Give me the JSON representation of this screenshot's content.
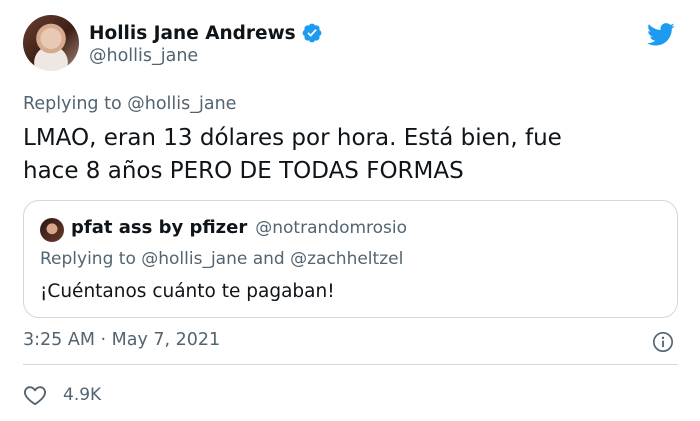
{
  "author": {
    "display_name": "Hollis Jane Andrews",
    "handle": "@hollis_jane",
    "verified": true,
    "avatar": "profile-photo"
  },
  "brand_icon": "twitter-bird-icon",
  "colors": {
    "brand_blue": "#1d9bf0",
    "text_primary": "#0f1419",
    "text_secondary": "#536471",
    "border": "#cfd9de"
  },
  "tweet": {
    "replying_prefix": "Replying to",
    "replying_handle": "@hollis_jane",
    "text_line1": "LMAO, eran 13 dólares por hora. Está bien, fue",
    "text_line2": "hace 8 años PERO DE TODAS FORMAS",
    "timestamp": "3:25 AM · May 7, 2021"
  },
  "quoted": {
    "display_name": "pfat ass by pfizer",
    "handle": "@notrandomrosio",
    "replying_line": "Replying to @hollis_jane and @zachheltzel",
    "text": "¡Cuéntanos cuánto te pagaban!"
  },
  "engagement": {
    "likes": "4.9K"
  }
}
